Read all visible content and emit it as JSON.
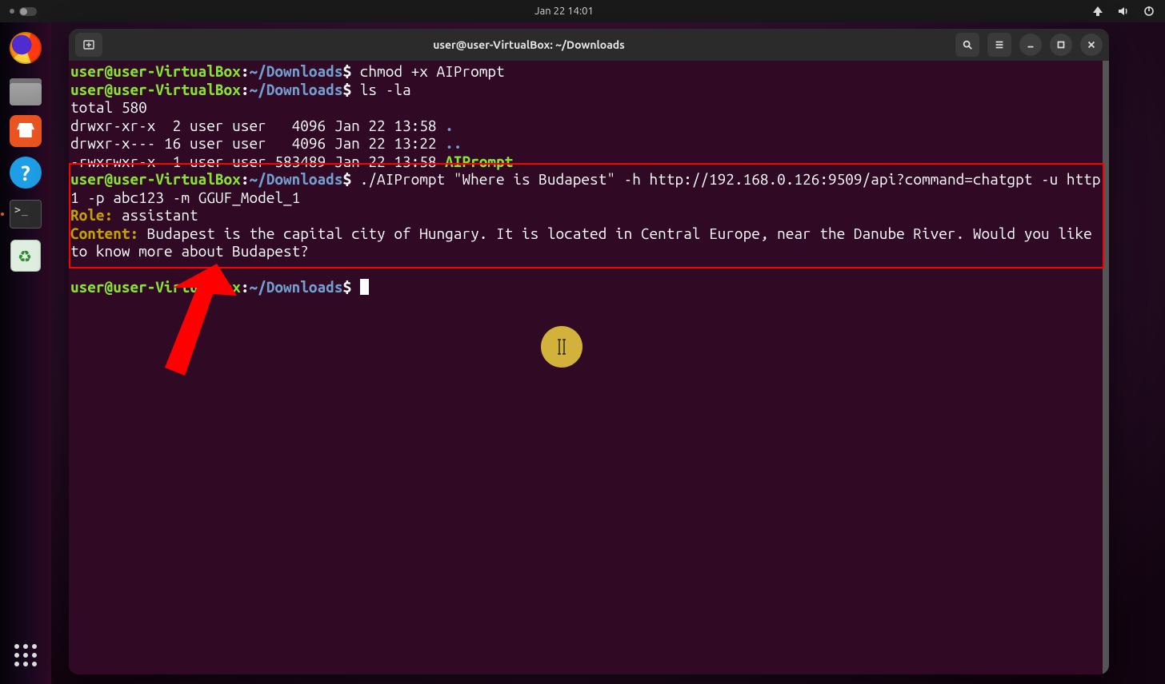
{
  "topbar": {
    "datetime": "Jan 22  14:01"
  },
  "window": {
    "title": "user@user-VirtualBox: ~/Downloads"
  },
  "prompt": {
    "user_host": "user@user-VirtualBox",
    "path": "~/Downloads",
    "separator": ":",
    "symbol": "$"
  },
  "lines": {
    "cmd1": " chmod +x AIPrompt",
    "cmd2": " ls -la",
    "ls_total": "total 580",
    "ls_row1_a": "drwxr-xr-x  2 user user   4096 Jan 22 13:58 ",
    "ls_row1_b": ".",
    "ls_row2_a": "drwxr-x--- 16 user user   4096 Jan 22 13:22 ",
    "ls_row2_b": "..",
    "ls_row3_a": "-rwxrwxr-x  1 user user 583489 Jan 22 13:58 ",
    "ls_row3_b": "AIPrompt",
    "cmd3": " ./AIPrompt \"Where is Budapest\" -h http://192.168.0.126:9509/api?command=chatgpt -u http1 -p abc123 -m GGUF_Model_1",
    "role_label": "Role:",
    "role_value": " assistant",
    "content_label": "Content:",
    "content_value": " Budapest is the capital city of Hungary. It is located in Central Europe, near the Danube River. Would you like to know more about Budapest?"
  },
  "annotations": {
    "highlight_box_visible": true,
    "arrow_visible": true,
    "cursor_highlight_visible": true
  }
}
